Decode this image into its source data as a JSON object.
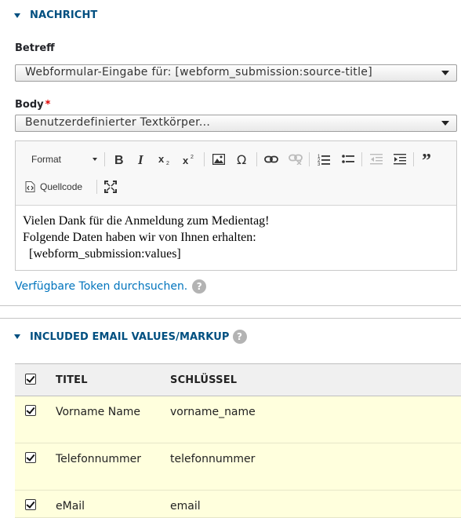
{
  "nachricht": {
    "section_title": "NACHRICHT",
    "betreff_label": "Betreff",
    "betreff_value": "Webformular-Eingabe für: [webform_submission:source-title]",
    "body_label": "Body",
    "body_required": "*",
    "body_select_value": "Benutzerdefinierter Textkörper...",
    "toolbar": {
      "format_label": "Format",
      "source_label": "Quellcode"
    },
    "content_lines": [
      "Vielen Dank für die Anmeldung zum Medientag!",
      "Folgende Daten haben wir von Ihnen erhalten:",
      "[webform_submission:values]"
    ],
    "token_link": "Verfügbare Token durchsuchen.",
    "help_glyph": "?"
  },
  "included": {
    "section_title": "INCLUDED EMAIL VALUES/MARKUP",
    "help_glyph": "?",
    "columns": [
      "TITEL",
      "SCHLÜSSEL"
    ],
    "rows": [
      {
        "title": "Vorname Name",
        "key": "vorname_name",
        "checked": true
      },
      {
        "title": "Telefonnummer",
        "key": "telefonnummer",
        "checked": true
      },
      {
        "title": "eMail",
        "key": "email",
        "checked": true
      }
    ]
  },
  "colors": {
    "section_title": "#004f80",
    "link": "#0074bd",
    "required": "#e00000",
    "row_highlight": "#ffffdd"
  }
}
